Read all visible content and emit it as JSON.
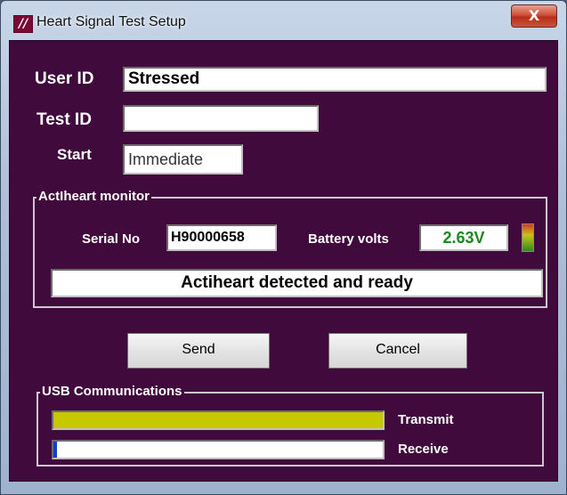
{
  "window": {
    "title": "Heart Signal Test Setup",
    "icon": "app-logo-icon",
    "close_glyph": "X"
  },
  "form": {
    "user_id_label": "User ID",
    "user_id_value": "Stressed",
    "test_id_label": "Test ID",
    "test_id_value": "",
    "start_label": "Start",
    "start_value": "Immediate"
  },
  "monitor": {
    "group_title": "ActIheart monitor",
    "serial_label": "Serial No",
    "serial_value": "H90000658",
    "battery_label": "Battery volts",
    "battery_value": "2.63V",
    "battery_indicator_colors": [
      "#2f8a1e",
      "#c9c21a",
      "#d83a1c"
    ],
    "status_text": "Actiheart detected and ready"
  },
  "buttons": {
    "send_label": "Send",
    "cancel_label": "Cancel"
  },
  "usb": {
    "group_title": "USB Communications",
    "transmit_label": "Transmit",
    "transmit_progress": 1.0,
    "transmit_color": "#c8c800",
    "receive_label": "Receive",
    "receive_progress": 0.01,
    "receive_color": "#1040c8"
  },
  "colors": {
    "background": "#400a3c",
    "battery_text": "#178a1e"
  }
}
